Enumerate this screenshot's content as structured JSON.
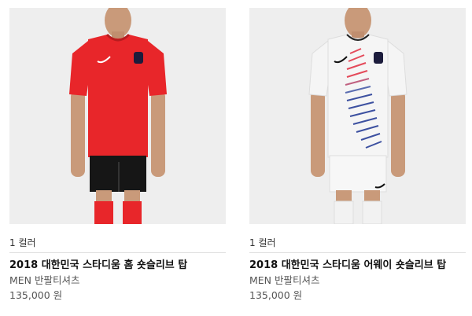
{
  "products": [
    {
      "color_count": "1 컬러",
      "title": "2018 대한민국 스타디움 홈 숏슬리브 탑",
      "category": "MEN 반팔티셔츠",
      "price": "135,000 원",
      "image_alt": "red home jersey",
      "jersey_color": "#e8262a",
      "shorts_color": "#161616",
      "socks_color": "#e8262a"
    },
    {
      "color_count": "1 컬러",
      "title": "2018 대한민국 스타디움 어웨이 숏슬리브 탑",
      "category": "MEN 반팔티셔츠",
      "price": "135,000 원",
      "image_alt": "white away jersey",
      "jersey_color": "#f5f5f5",
      "shorts_color": "#f7f7f7",
      "socks_color": "#f2f2f2"
    }
  ]
}
